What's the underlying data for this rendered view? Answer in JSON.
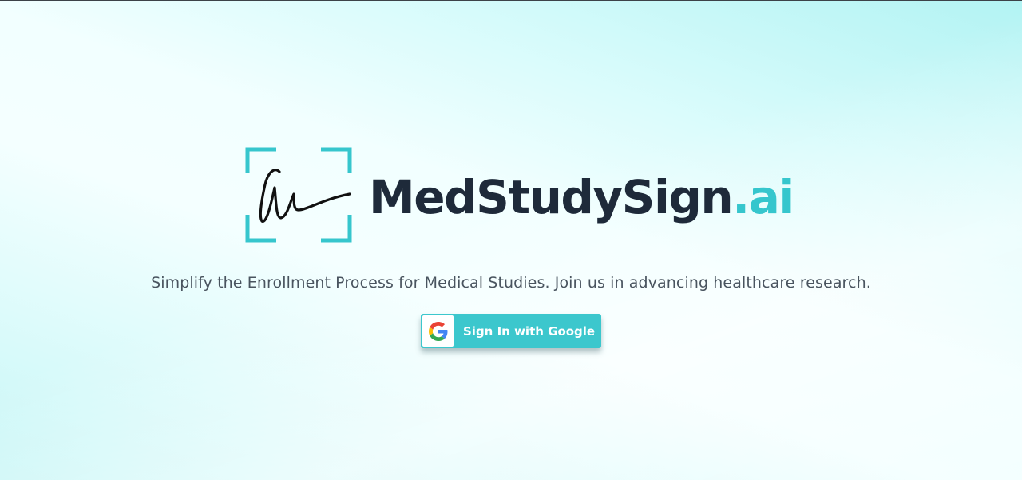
{
  "brand": {
    "name_main": "MedStudySign",
    "name_suffix": ".ai",
    "accent_color": "#36c6cd",
    "text_color": "#1e2a3a",
    "logo_icon": "signature-frame-icon"
  },
  "hero": {
    "tagline": "Simplify the Enrollment Process for Medical Studies. Join us in advancing healthcare research."
  },
  "auth": {
    "google_button_label": "Sign In with Google",
    "google_icon": "google-g-icon",
    "button_color": "#3cc7cd"
  }
}
